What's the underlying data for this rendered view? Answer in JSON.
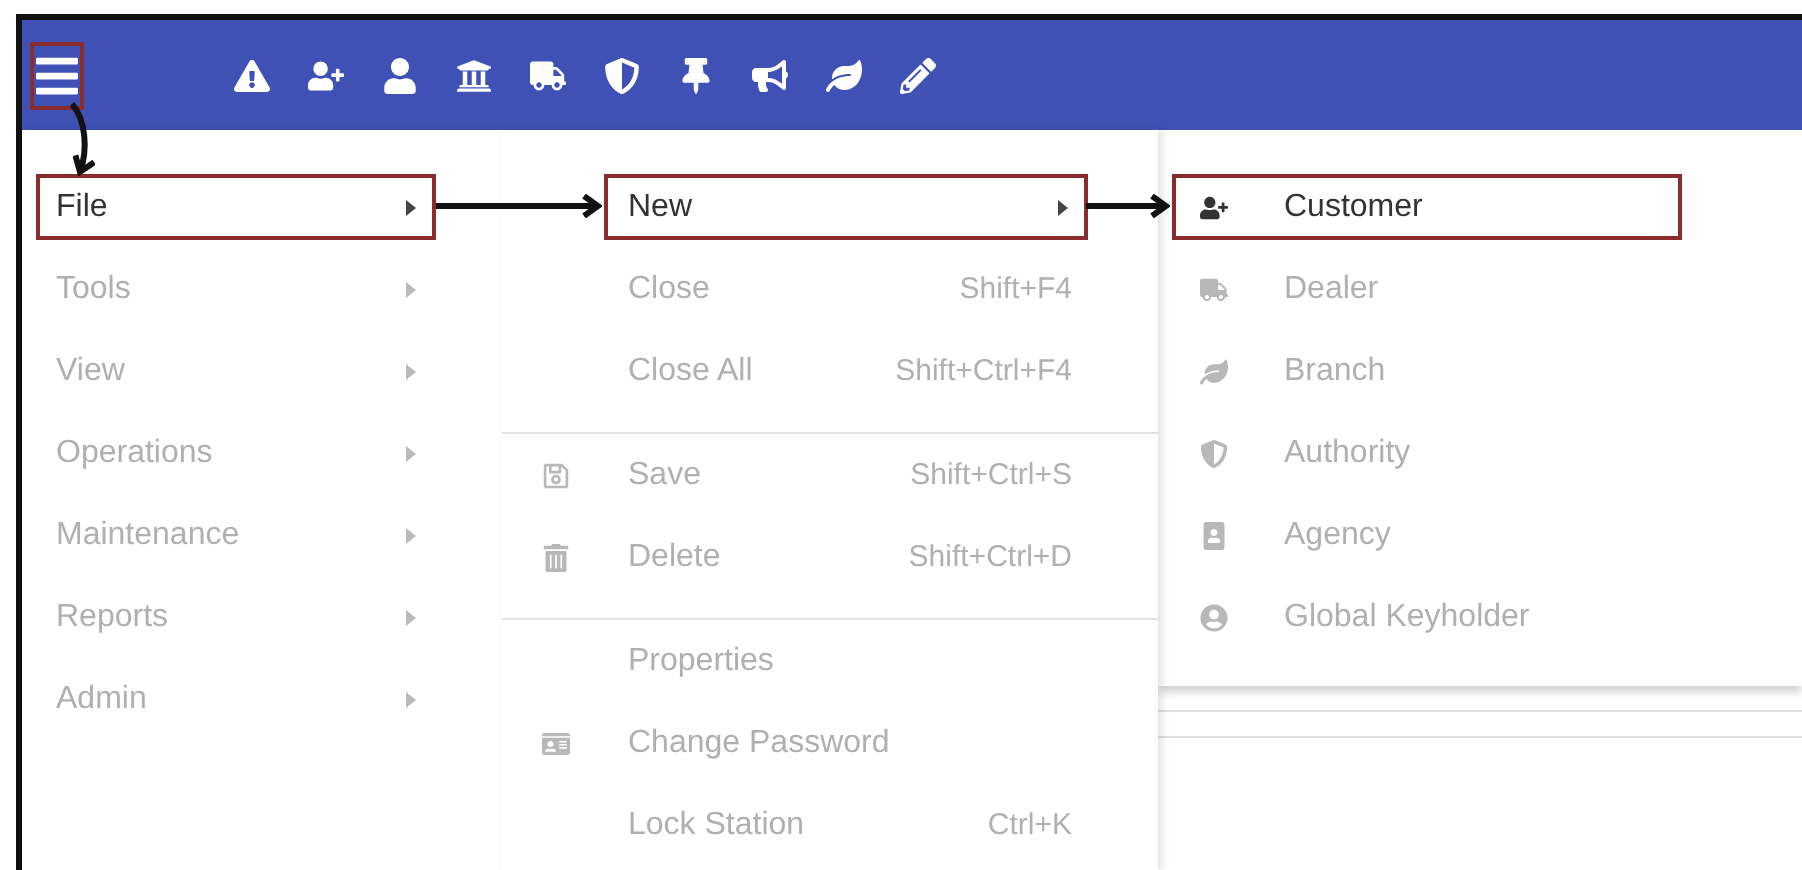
{
  "toolbar": {
    "menu_button": {
      "selected": true
    },
    "icons": [
      {
        "kind": "warning"
      },
      {
        "kind": "user-plus"
      },
      {
        "kind": "user"
      },
      {
        "kind": "bank"
      },
      {
        "kind": "truck"
      },
      {
        "kind": "shield"
      },
      {
        "kind": "pin"
      },
      {
        "kind": "bullhorn"
      },
      {
        "kind": "leaf"
      },
      {
        "kind": "pencil"
      }
    ]
  },
  "main_menu": {
    "items": [
      {
        "label": "File",
        "selected": true
      },
      {
        "label": "Tools",
        "selected": false
      },
      {
        "label": "View",
        "selected": false
      },
      {
        "label": "Operations",
        "selected": false
      },
      {
        "label": "Maintenance",
        "selected": false
      },
      {
        "label": "Reports",
        "selected": false
      },
      {
        "label": "Admin",
        "selected": false
      }
    ]
  },
  "file_menu": {
    "groups": [
      [
        {
          "label": "New",
          "submenu": true,
          "selected": true
        },
        {
          "label": "Close",
          "shortcut": "Shift+F4",
          "selected": false
        },
        {
          "label": "Close All",
          "shortcut": "Shift+Ctrl+F4",
          "selected": false
        }
      ],
      [
        {
          "label": "Save",
          "kind": "save",
          "shortcut": "Shift+Ctrl+S",
          "selected": false
        },
        {
          "label": "Delete",
          "kind": "trash",
          "shortcut": "Shift+Ctrl+D",
          "selected": false
        }
      ],
      [
        {
          "label": "Properties",
          "selected": false
        },
        {
          "label": "Change Password",
          "kind": "id-card",
          "selected": false
        },
        {
          "label": "Lock Station",
          "shortcut": "Ctrl+K",
          "selected": false
        }
      ]
    ]
  },
  "new_menu": {
    "items": [
      {
        "label": "Customer",
        "kind": "user-plus",
        "selected": true
      },
      {
        "label": "Dealer",
        "kind": "truck",
        "selected": false
      },
      {
        "label": "Branch",
        "kind": "leaf",
        "selected": false
      },
      {
        "label": "Authority",
        "kind": "shield",
        "selected": false
      },
      {
        "label": "Agency",
        "kind": "portrait",
        "selected": false
      },
      {
        "label": "Global Keyholder",
        "kind": "circle-user",
        "selected": false
      }
    ]
  }
}
